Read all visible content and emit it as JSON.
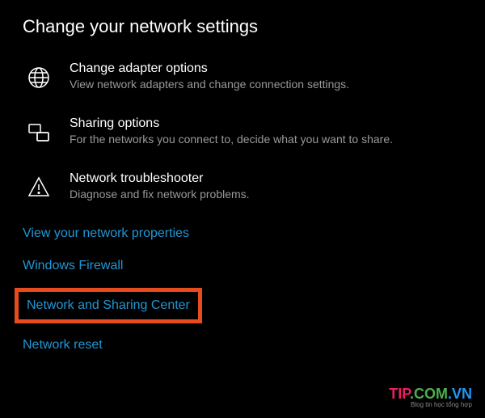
{
  "header": "Change your network settings",
  "items": [
    {
      "title": "Change adapter options",
      "subtitle": "View network adapters and change connection settings."
    },
    {
      "title": "Sharing options",
      "subtitle": "For the networks you connect to, decide what you want to share."
    },
    {
      "title": "Network troubleshooter",
      "subtitle": "Diagnose and fix network problems."
    }
  ],
  "links": {
    "view_properties": "View your network properties",
    "firewall": "Windows Firewall",
    "sharing_center": "Network and Sharing Center",
    "reset": "Network reset"
  },
  "watermark": {
    "brand_tip": "TIP",
    "brand_com": ".COM",
    "brand_vn": ".VN",
    "tagline": "Blog tin học tổng hợp"
  }
}
